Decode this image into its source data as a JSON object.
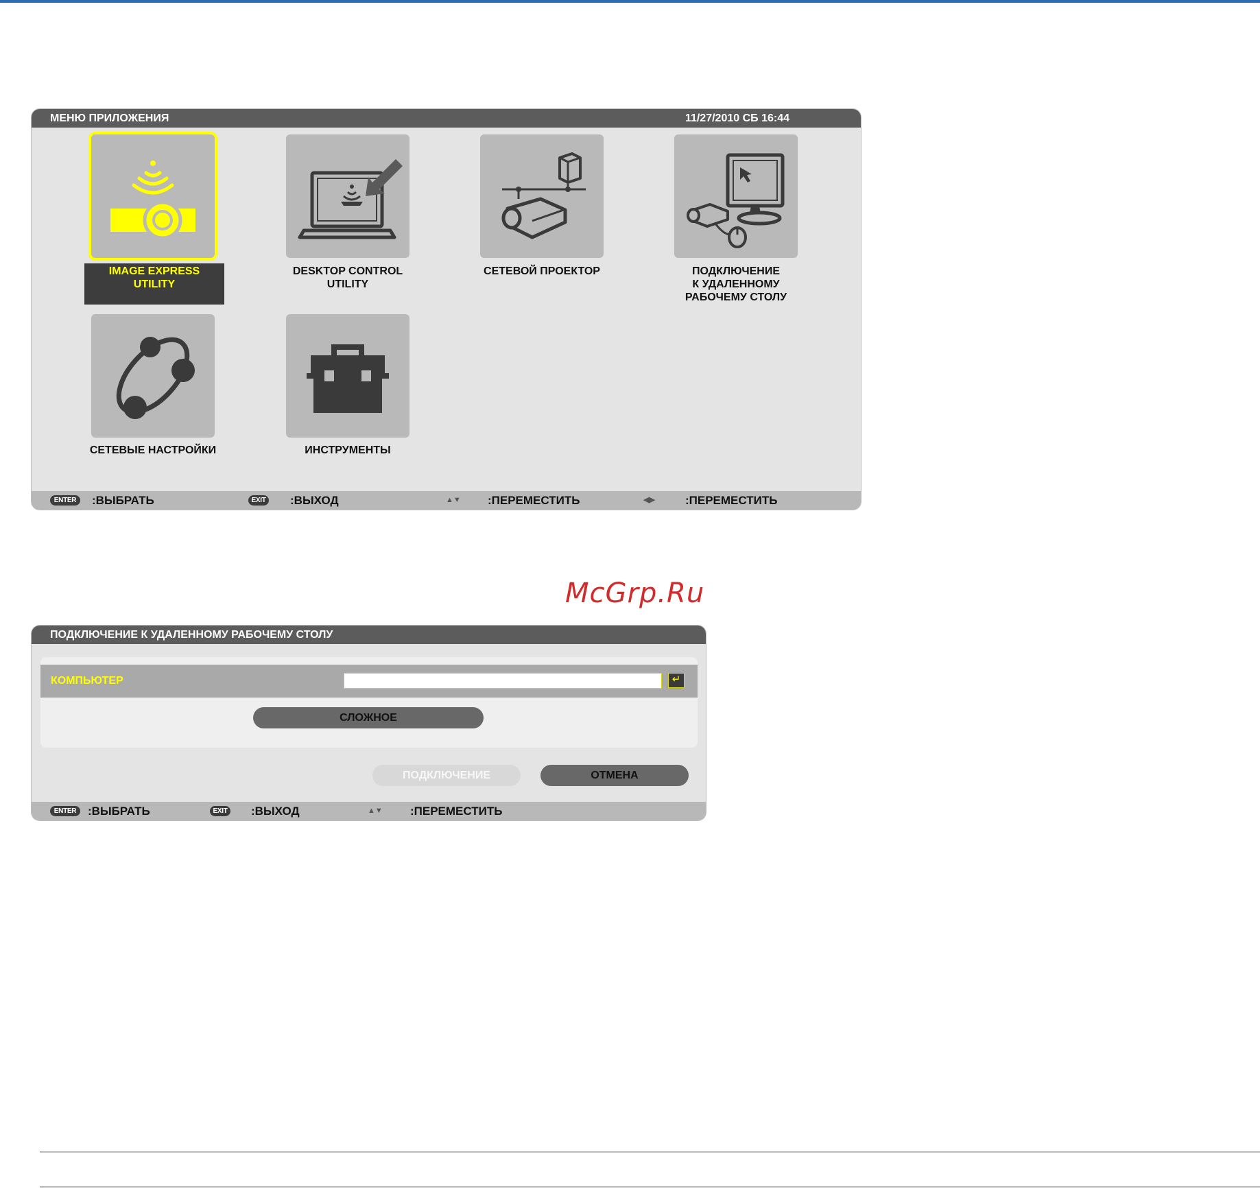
{
  "watermark": "McGrp.Ru",
  "app_menu": {
    "title": "МЕНЮ ПРИЛОЖЕНИЯ",
    "datetime": "11/27/2010 СБ 16:44",
    "tiles": [
      {
        "label": "IMAGE EXPRESS\nUTILITY",
        "icon": "wireless-projector-icon",
        "selected": true
      },
      {
        "label": "DESKTOP CONTROL\nUTILITY",
        "icon": "laptop-arrow-icon",
        "selected": false
      },
      {
        "label": "СЕТЕВОЙ ПРОЕКТОР",
        "icon": "network-projector-icon",
        "selected": false
      },
      {
        "label": "ПОДКЛЮЧЕНИЕ\nК УДАЛЕННОМУ\nРАБОЧЕМУ СТОЛУ",
        "icon": "remote-desktop-icon",
        "selected": false
      },
      {
        "label": "СЕТЕВЫЕ НАСТРОЙКИ",
        "icon": "network-settings-icon",
        "selected": false
      },
      {
        "label": "ИНСТРУМЕНТЫ",
        "icon": "toolbox-icon",
        "selected": false
      }
    ],
    "footer": {
      "enter_key": "ENTER",
      "enter_text": ":ВЫБРАТЬ",
      "exit_key": "EXIT",
      "exit_text": ":ВЫХОД",
      "updown_text": ":ПЕРЕМЕСТИТЬ",
      "leftright_text": ":ПЕРЕМЕСТИТЬ"
    }
  },
  "remote_dialog": {
    "title": "ПОДКЛЮЧЕНИЕ К УДАЛЕННОМУ РАБОЧЕМУ СТОЛУ",
    "computer_label": "КОМПЬЮТЕР",
    "computer_value": "",
    "advanced_button": "СЛОЖНОЕ",
    "connect_button": "ПОДКЛЮЧЕНИЕ",
    "cancel_button": "ОТМЕНА",
    "footer": {
      "enter_key": "ENTER",
      "enter_text": ":ВЫБРАТЬ",
      "exit_key": "EXIT",
      "exit_text": ":ВЫХОД",
      "updown_text": ":ПЕРЕМЕСТИТЬ"
    }
  },
  "colors": {
    "highlight": "#ffff00",
    "titlebar": "#5c5c5c",
    "panel": "#e4e4e4",
    "tile": "#b9b9b9",
    "icon": "#3a3a3a"
  }
}
